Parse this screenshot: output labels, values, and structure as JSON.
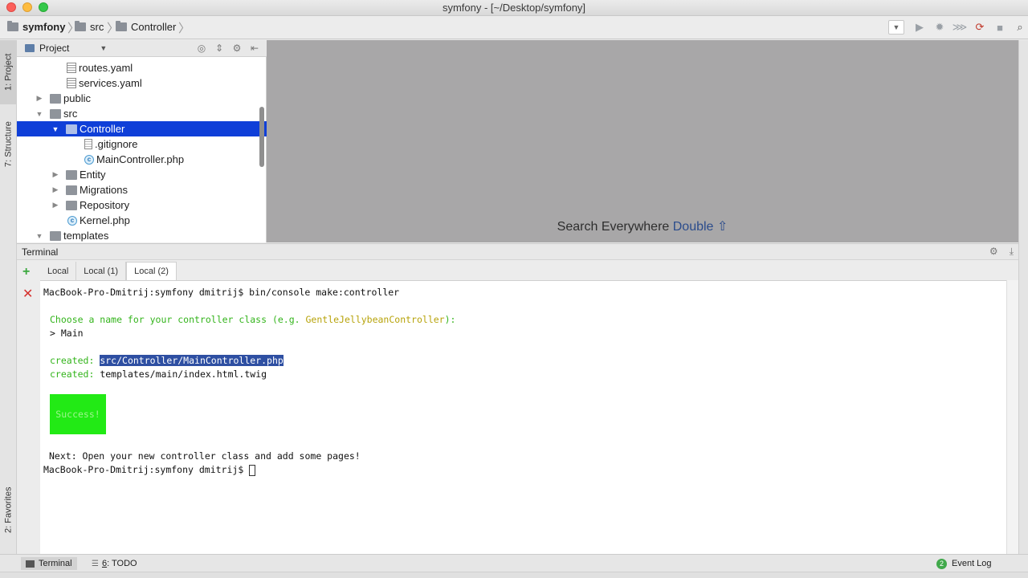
{
  "window": {
    "title": "symfony - [~/Desktop/symfony]"
  },
  "breadcrumb": {
    "items": [
      "symfony",
      "src",
      "Controller"
    ]
  },
  "stripe": {
    "project": "1: Project",
    "structure": "7: Structure",
    "favorites": "2: Favorites"
  },
  "project_panel": {
    "title": "Project",
    "tree": [
      {
        "label": "routes.yaml",
        "type": "yaml",
        "level": 3
      },
      {
        "label": "services.yaml",
        "type": "yaml",
        "level": 3
      },
      {
        "label": "public",
        "type": "folder",
        "expanded": false,
        "level": 1
      },
      {
        "label": "src",
        "type": "folder",
        "expanded": true,
        "level": 1
      },
      {
        "label": "Controller",
        "type": "folder",
        "expanded": true,
        "level": 2,
        "selected": true
      },
      {
        "label": ".gitignore",
        "type": "file",
        "level": 4
      },
      {
        "label": "MainController.php",
        "type": "class",
        "level": 4
      },
      {
        "label": "Entity",
        "type": "folder",
        "expanded": false,
        "level": 2
      },
      {
        "label": "Migrations",
        "type": "folder",
        "expanded": false,
        "level": 2
      },
      {
        "label": "Repository",
        "type": "folder",
        "expanded": false,
        "level": 2
      },
      {
        "label": "Kernel.php",
        "type": "class",
        "level": 3
      },
      {
        "label": "templates",
        "type": "folder",
        "expanded": true,
        "level": 1
      }
    ]
  },
  "editor": {
    "hint_text": "Search Everywhere",
    "hint_key": "Double ⇧"
  },
  "terminal": {
    "title": "Terminal",
    "tabs": [
      "Local",
      "Local (1)",
      "Local (2)"
    ],
    "active_tab": 2,
    "lines": {
      "cmd": "MacBook-Pro-Dmitrij:symfony dmitrij$ bin/console make:controller",
      "choose_prefix": "Choose a name for your controller class (e.g. ",
      "choose_example": "GentleJellybeanController",
      "choose_suffix": "):",
      "answer": "> Main",
      "created_label": "created:",
      "created_1": "src/Controller/MainController.php",
      "created_2": "templates/main/index.html.twig",
      "success": "Success!",
      "next": "Next: Open your new controller class and add some pages!",
      "prompt": "MacBook-Pro-Dmitrij:symfony dmitrij$ "
    }
  },
  "bottombar": {
    "terminal": "Terminal",
    "todo_num": "6",
    "todo": ": TODO",
    "event_log_count": "2",
    "event_log": "Event Log"
  },
  "colors": {
    "selection": "#0f3fd8",
    "green_text": "#33b41b",
    "success_bg": "#22ea15"
  }
}
